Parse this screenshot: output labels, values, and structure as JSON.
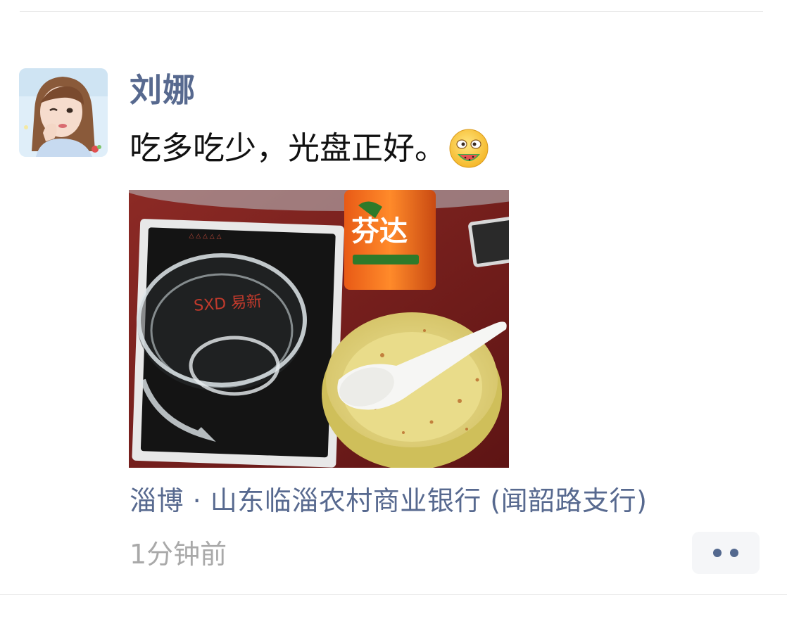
{
  "post": {
    "author": "刘娜",
    "text": "吃多吃少，光盘正好。",
    "emoji": "melon-eating-face-emoji",
    "location": "淄博 · 山东临淄农村商业银行 (闻韶路支行)",
    "timestamp": "1分钟前"
  },
  "photo": {
    "subject": "empty-bowls-photo",
    "can_label": "芬达"
  },
  "colors": {
    "name_link": "#57698f",
    "timestamp_gray": "#a9a9a9",
    "more_button_bg": "#f5f6f8"
  }
}
